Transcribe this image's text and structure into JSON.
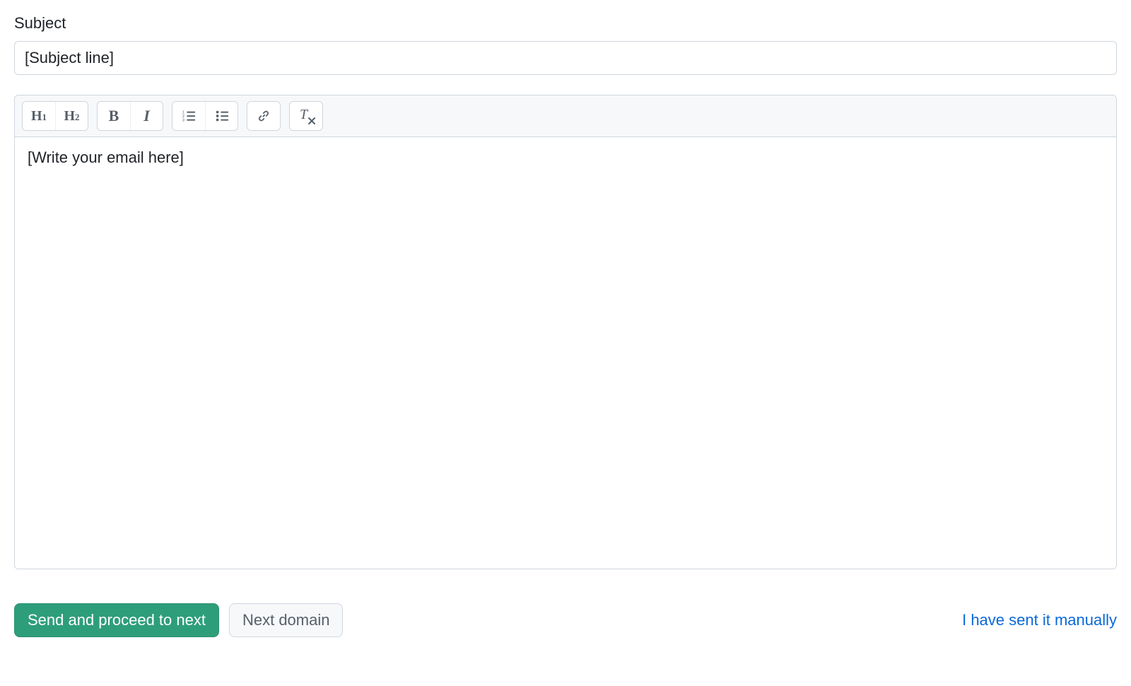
{
  "subject": {
    "label": "Subject",
    "value": "[Subject line]"
  },
  "toolbar": {
    "icons": {
      "h1": "heading-1-icon",
      "h2": "heading-2-icon",
      "bold": "bold-icon",
      "italic": "italic-icon",
      "ordered_list": "ordered-list-icon",
      "unordered_list": "unordered-list-icon",
      "link": "link-icon",
      "clear_formatting": "clear-formatting-icon"
    }
  },
  "editor": {
    "content": "[Write your email here]"
  },
  "actions": {
    "send_label": "Send and proceed to next",
    "next_domain_label": "Next domain",
    "manual_link_label": "I have sent it manually"
  }
}
